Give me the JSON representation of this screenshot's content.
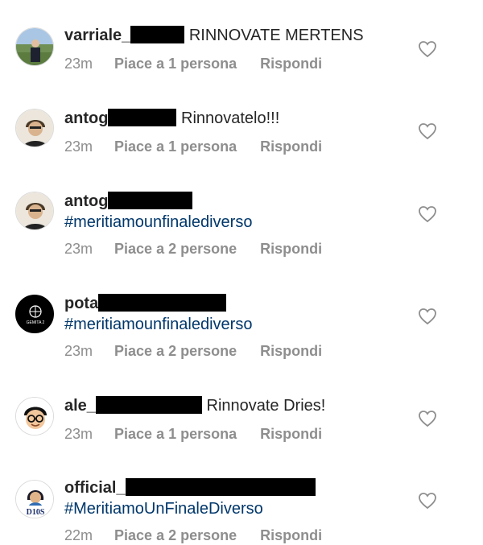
{
  "comments": [
    {
      "username": "varriale_",
      "text": "RINNOVATE MERTENS",
      "hashtag": "",
      "time": "23m",
      "likes": "Piace a 1 persona",
      "reply": "Rispondi"
    },
    {
      "username": "antog",
      "text": "Rinnovatelo!!!",
      "hashtag": "",
      "time": "23m",
      "likes": "Piace a 1 persona",
      "reply": "Rispondi"
    },
    {
      "username": "antog",
      "text": "",
      "hashtag": "#meritiamounfinalediverso",
      "time": "23m",
      "likes": "Piace a 2 persone",
      "reply": "Rispondi"
    },
    {
      "username": "pota",
      "text": "",
      "hashtag": "#meritiamounfinalediverso",
      "time": "23m",
      "likes": "Piace a 2 persone",
      "reply": "Rispondi"
    },
    {
      "username": "ale_",
      "text": "Rinnovate Dries!",
      "hashtag": "",
      "time": "23m",
      "likes": "Piace a 1 persona",
      "reply": "Rispondi"
    },
    {
      "username": "official_",
      "text": "",
      "hashtag": "#MeritiamoUnFinaleDiverso",
      "time": "22m",
      "likes": "Piace a 2 persone",
      "reply": "Rispondi"
    }
  ],
  "avatar_labels": {
    "d10s": "D10S",
    "gemita": "GEMITA 2"
  },
  "colors": {
    "hashtag": "#00376b",
    "meta": "#8e8e8e",
    "text": "#262626"
  }
}
